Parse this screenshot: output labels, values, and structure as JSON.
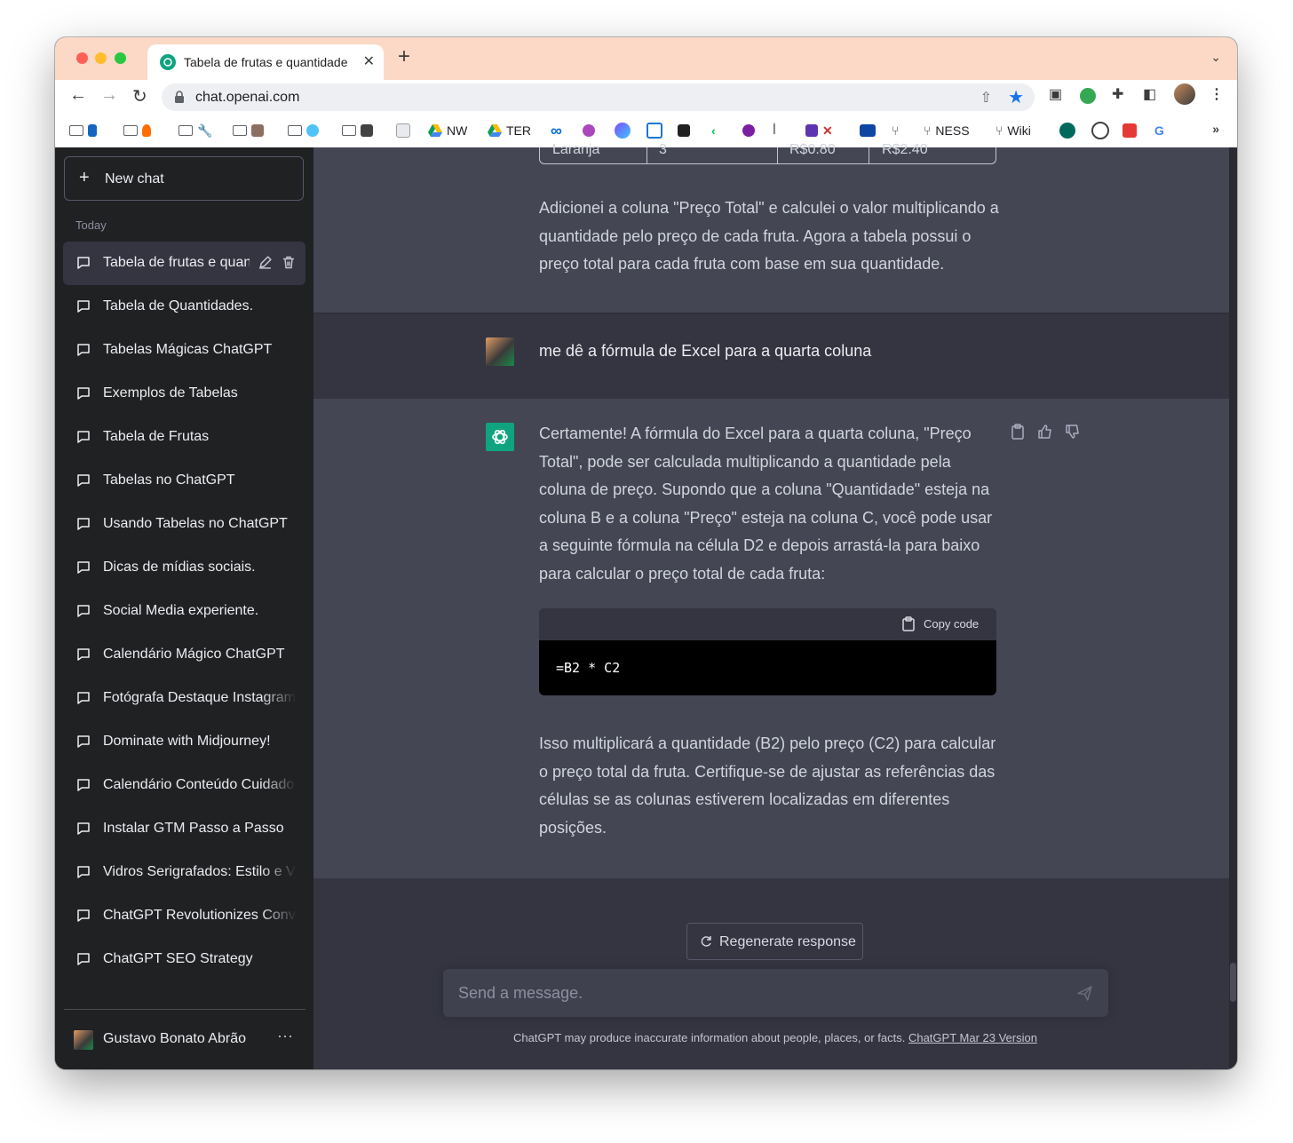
{
  "browser": {
    "tab_title": "Tabela de frutas e quantidade",
    "url": "chat.openai.com",
    "bookmarks": [
      {
        "label": "NW",
        "icon": "google-drive-icon"
      },
      {
        "label": "TER",
        "icon": "google-drive-icon"
      },
      {
        "label": "NESS",
        "icon": "fork-icon"
      },
      {
        "label": "Wiki",
        "icon": "fork-icon"
      }
    ],
    "more_bookmarks": "»"
  },
  "sidebar": {
    "new_chat_label": "New chat",
    "section_label": "Today",
    "items": [
      {
        "label": "Tabela de frutas e quantidade"
      },
      {
        "label": "Tabela de Quantidades."
      },
      {
        "label": "Tabelas Mágicas ChatGPT"
      },
      {
        "label": "Exemplos de Tabelas"
      },
      {
        "label": "Tabela de Frutas"
      },
      {
        "label": "Tabelas no ChatGPT"
      },
      {
        "label": "Usando Tabelas no ChatGPT"
      },
      {
        "label": "Dicas de mídias sociais."
      },
      {
        "label": "Social Media experiente."
      },
      {
        "label": "Calendário Mágico ChatGPT"
      },
      {
        "label": "Fotógrafa Destaque Instagram"
      },
      {
        "label": "Dominate with Midjourney!"
      },
      {
        "label": "Calendário Conteúdo Cuidado"
      },
      {
        "label": "Instalar GTM Passo a Passo"
      },
      {
        "label": "Vidros Serigrafados: Estilo e V"
      },
      {
        "label": "ChatGPT Revolutionizes Conv"
      },
      {
        "label": "ChatGPT SEO Strategy"
      }
    ],
    "user_name": "Gustavo Bonato Abrão",
    "user_menu": "···"
  },
  "conversation": {
    "table_tail": [
      "Laranja",
      "3",
      "R$0.80",
      "R$2.40"
    ],
    "prev_reply": "Adicionei a coluna \"Preço Total\" e calculei o valor multiplicando a quantidade pelo preço de cada fruta. Agora a tabela possui o preço total para cada fruta com base em sua quantidade.",
    "user_message": "me dê a  fórmula de Excel para a quarta coluna",
    "reply_intro": "Certamente! A fórmula do Excel para a quarta coluna, \"Preço Total\", pode ser calculada multiplicando a quantidade pela coluna de preço. Supondo que a coluna \"Quantidade\" esteja na coluna B e a coluna \"Preço\" esteja na coluna C, você pode usar a seguinte fórmula na célula D2 e depois arrastá-la para baixo para calcular o preço total de cada fruta:",
    "copy_code_label": "Copy code",
    "code": "=B2 * C2",
    "reply_outro": "Isso multiplicará a quantidade (B2) pelo preço (C2) para calcular o preço total da fruta. Certifique-se de ajustar as referências das células se as colunas estiverem localizadas em diferentes posições."
  },
  "composer": {
    "regenerate_label": "Regenerate response",
    "placeholder": "Send a message.",
    "disclaimer": "ChatGPT may produce inaccurate information about people, places, or facts.",
    "version_link": "ChatGPT Mar 23 Version"
  },
  "colors": {
    "sidebar_bg": "#202123",
    "main_bg": "#343541",
    "assistant_bg": "#444654",
    "accent": "#10a37f"
  }
}
